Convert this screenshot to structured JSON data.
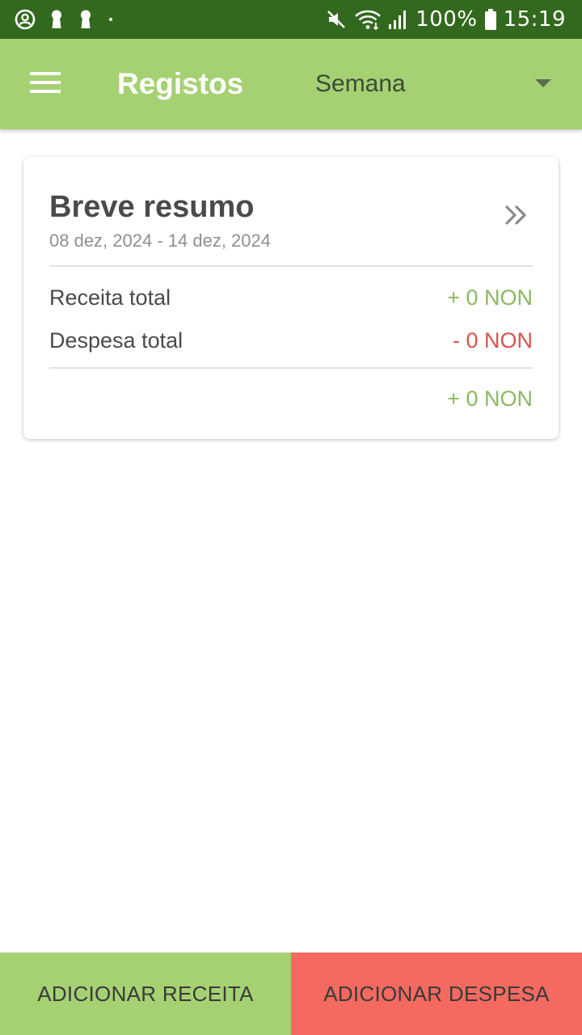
{
  "status_bar": {
    "battery_percent": "100%",
    "time": "15:19",
    "background_color": "#33691e",
    "icons_left": [
      "account-circle-icon",
      "keyhole-icon",
      "keyhole-icon",
      "notification-dot-icon"
    ],
    "icons_right": [
      "mute-icon",
      "wifi-icon",
      "signal-icon",
      "battery-icon"
    ]
  },
  "app_bar": {
    "title": "Registos",
    "period_selected": "Semana",
    "background_color": "#a5d173",
    "menu_icon": "hamburger-menu-icon",
    "dropdown_icon": "caret-down-icon"
  },
  "summary": {
    "title": "Breve resumo",
    "date_range": "08 dez, 2024 - 14 dez, 2024",
    "more_icon": "double-chevron-right-icon",
    "income_label": "Receita total",
    "income_value": "+ 0 NON",
    "expense_label": "Despesa total",
    "expense_value": "- 0 NON",
    "balance_value": "+ 0 NON",
    "positive_color": "#8bb862",
    "negative_color": "#d9534f"
  },
  "actions": {
    "add_income_label": "ADICIONAR RECEITA",
    "add_expense_label": "ADICIONAR DESPESA",
    "income_color": "#a5d173",
    "expense_color": "#f56a60"
  }
}
